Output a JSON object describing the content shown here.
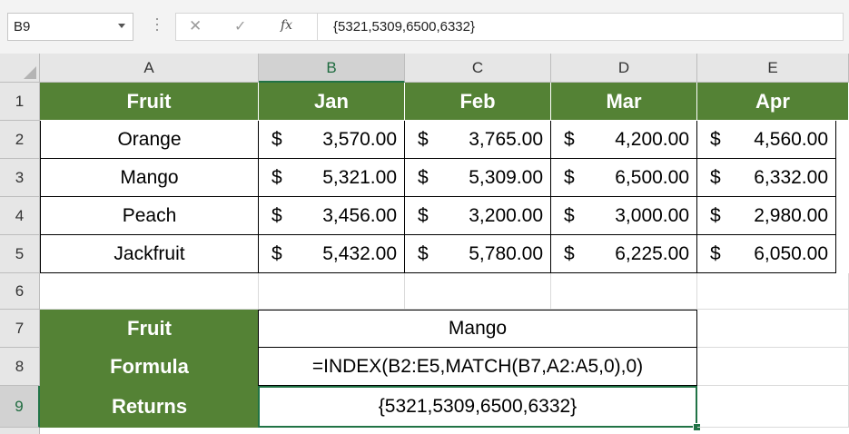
{
  "formula_bar": {
    "name_box": "B9",
    "fx_label": "fx",
    "formula": "{5321,5309,6500,6332}"
  },
  "columns": [
    "A",
    "B",
    "C",
    "D",
    "E"
  ],
  "rows": [
    "1",
    "2",
    "3",
    "4",
    "5",
    "6",
    "7",
    "8",
    "9"
  ],
  "table": {
    "headers": [
      "Fruit",
      "Jan",
      "Feb",
      "Mar",
      "Apr"
    ],
    "currency_symbol": "$",
    "rows": [
      {
        "fruit": "Orange",
        "values": [
          "3,570.00",
          "3,765.00",
          "4,200.00",
          "4,560.00"
        ]
      },
      {
        "fruit": "Mango",
        "values": [
          "5,321.00",
          "5,309.00",
          "6,500.00",
          "6,332.00"
        ]
      },
      {
        "fruit": "Peach",
        "values": [
          "3,456.00",
          "3,200.00",
          "3,000.00",
          "2,980.00"
        ]
      },
      {
        "fruit": "Jackfruit",
        "values": [
          "5,432.00",
          "5,780.00",
          "6,225.00",
          "6,050.00"
        ]
      }
    ]
  },
  "lookup": {
    "fruit_label": "Fruit",
    "fruit_value": "Mango",
    "formula_label": "Formula",
    "formula_value": "=INDEX(B2:E5,MATCH(B7,A2:A5,0),0)",
    "returns_label": "Returns",
    "returns_value": "{5321,5309,6500,6332}"
  },
  "colors": {
    "header_green": "#548235",
    "selection_green": "#217346"
  }
}
